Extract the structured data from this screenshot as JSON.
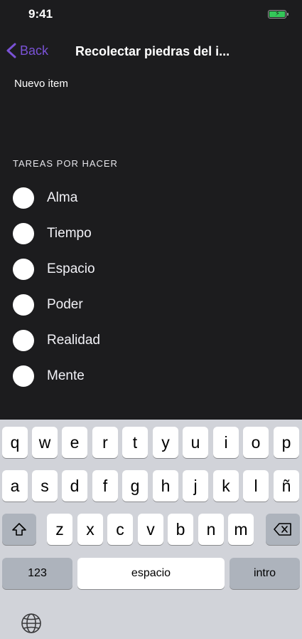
{
  "status": {
    "time": "9:41"
  },
  "nav": {
    "back_label": "Back",
    "title": "Recolectar piedras del i..."
  },
  "new_item": {
    "placeholder": "Nuevo item"
  },
  "section": {
    "header": "TAREAS POR HACER"
  },
  "tasks": [
    "Alma",
    "Tiempo",
    "Espacio",
    "Poder",
    "Realidad",
    "Mente"
  ],
  "keyboard": {
    "row1": [
      "q",
      "w",
      "e",
      "r",
      "t",
      "y",
      "u",
      "i",
      "o",
      "p"
    ],
    "row2": [
      "a",
      "s",
      "d",
      "f",
      "g",
      "h",
      "j",
      "k",
      "l",
      "ñ"
    ],
    "row3": [
      "z",
      "x",
      "c",
      "v",
      "b",
      "n",
      "m"
    ],
    "numbers_label": "123",
    "space_label": "espacio",
    "return_label": "intro"
  },
  "colors": {
    "accent": "#7a52d6",
    "background": "#1c1c1e",
    "battery": "#34c759"
  }
}
